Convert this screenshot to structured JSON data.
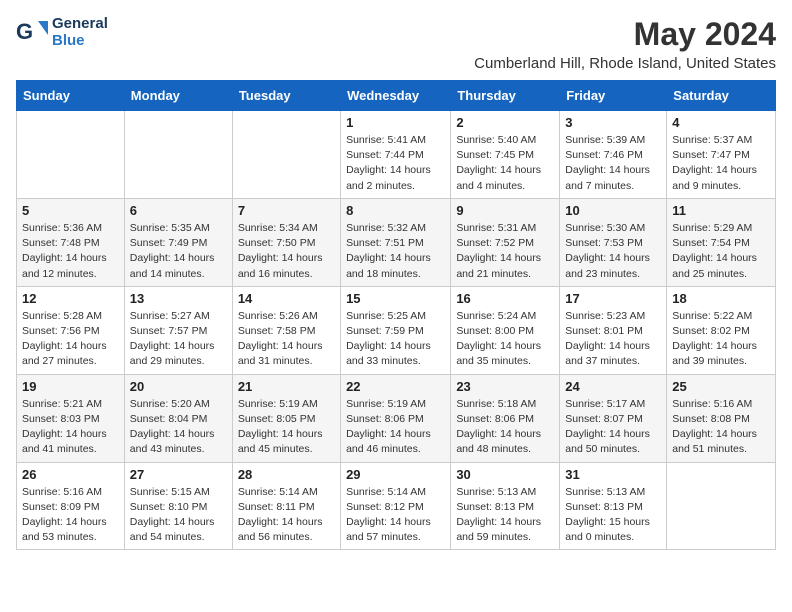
{
  "logo": {
    "line1": "General",
    "line2": "Blue",
    "tagline": ""
  },
  "title": "May 2024",
  "subtitle": "Cumberland Hill, Rhode Island, United States",
  "weekdays": [
    "Sunday",
    "Monday",
    "Tuesday",
    "Wednesday",
    "Thursday",
    "Friday",
    "Saturday"
  ],
  "weeks": [
    [
      {
        "day": "",
        "info": ""
      },
      {
        "day": "",
        "info": ""
      },
      {
        "day": "",
        "info": ""
      },
      {
        "day": "1",
        "info": "Sunrise: 5:41 AM\nSunset: 7:44 PM\nDaylight: 14 hours\nand 2 minutes."
      },
      {
        "day": "2",
        "info": "Sunrise: 5:40 AM\nSunset: 7:45 PM\nDaylight: 14 hours\nand 4 minutes."
      },
      {
        "day": "3",
        "info": "Sunrise: 5:39 AM\nSunset: 7:46 PM\nDaylight: 14 hours\nand 7 minutes."
      },
      {
        "day": "4",
        "info": "Sunrise: 5:37 AM\nSunset: 7:47 PM\nDaylight: 14 hours\nand 9 minutes."
      }
    ],
    [
      {
        "day": "5",
        "info": "Sunrise: 5:36 AM\nSunset: 7:48 PM\nDaylight: 14 hours\nand 12 minutes."
      },
      {
        "day": "6",
        "info": "Sunrise: 5:35 AM\nSunset: 7:49 PM\nDaylight: 14 hours\nand 14 minutes."
      },
      {
        "day": "7",
        "info": "Sunrise: 5:34 AM\nSunset: 7:50 PM\nDaylight: 14 hours\nand 16 minutes."
      },
      {
        "day": "8",
        "info": "Sunrise: 5:32 AM\nSunset: 7:51 PM\nDaylight: 14 hours\nand 18 minutes."
      },
      {
        "day": "9",
        "info": "Sunrise: 5:31 AM\nSunset: 7:52 PM\nDaylight: 14 hours\nand 21 minutes."
      },
      {
        "day": "10",
        "info": "Sunrise: 5:30 AM\nSunset: 7:53 PM\nDaylight: 14 hours\nand 23 minutes."
      },
      {
        "day": "11",
        "info": "Sunrise: 5:29 AM\nSunset: 7:54 PM\nDaylight: 14 hours\nand 25 minutes."
      }
    ],
    [
      {
        "day": "12",
        "info": "Sunrise: 5:28 AM\nSunset: 7:56 PM\nDaylight: 14 hours\nand 27 minutes."
      },
      {
        "day": "13",
        "info": "Sunrise: 5:27 AM\nSunset: 7:57 PM\nDaylight: 14 hours\nand 29 minutes."
      },
      {
        "day": "14",
        "info": "Sunrise: 5:26 AM\nSunset: 7:58 PM\nDaylight: 14 hours\nand 31 minutes."
      },
      {
        "day": "15",
        "info": "Sunrise: 5:25 AM\nSunset: 7:59 PM\nDaylight: 14 hours\nand 33 minutes."
      },
      {
        "day": "16",
        "info": "Sunrise: 5:24 AM\nSunset: 8:00 PM\nDaylight: 14 hours\nand 35 minutes."
      },
      {
        "day": "17",
        "info": "Sunrise: 5:23 AM\nSunset: 8:01 PM\nDaylight: 14 hours\nand 37 minutes."
      },
      {
        "day": "18",
        "info": "Sunrise: 5:22 AM\nSunset: 8:02 PM\nDaylight: 14 hours\nand 39 minutes."
      }
    ],
    [
      {
        "day": "19",
        "info": "Sunrise: 5:21 AM\nSunset: 8:03 PM\nDaylight: 14 hours\nand 41 minutes."
      },
      {
        "day": "20",
        "info": "Sunrise: 5:20 AM\nSunset: 8:04 PM\nDaylight: 14 hours\nand 43 minutes."
      },
      {
        "day": "21",
        "info": "Sunrise: 5:19 AM\nSunset: 8:05 PM\nDaylight: 14 hours\nand 45 minutes."
      },
      {
        "day": "22",
        "info": "Sunrise: 5:19 AM\nSunset: 8:06 PM\nDaylight: 14 hours\nand 46 minutes."
      },
      {
        "day": "23",
        "info": "Sunrise: 5:18 AM\nSunset: 8:06 PM\nDaylight: 14 hours\nand 48 minutes."
      },
      {
        "day": "24",
        "info": "Sunrise: 5:17 AM\nSunset: 8:07 PM\nDaylight: 14 hours\nand 50 minutes."
      },
      {
        "day": "25",
        "info": "Sunrise: 5:16 AM\nSunset: 8:08 PM\nDaylight: 14 hours\nand 51 minutes."
      }
    ],
    [
      {
        "day": "26",
        "info": "Sunrise: 5:16 AM\nSunset: 8:09 PM\nDaylight: 14 hours\nand 53 minutes."
      },
      {
        "day": "27",
        "info": "Sunrise: 5:15 AM\nSunset: 8:10 PM\nDaylight: 14 hours\nand 54 minutes."
      },
      {
        "day": "28",
        "info": "Sunrise: 5:14 AM\nSunset: 8:11 PM\nDaylight: 14 hours\nand 56 minutes."
      },
      {
        "day": "29",
        "info": "Sunrise: 5:14 AM\nSunset: 8:12 PM\nDaylight: 14 hours\nand 57 minutes."
      },
      {
        "day": "30",
        "info": "Sunrise: 5:13 AM\nSunset: 8:13 PM\nDaylight: 14 hours\nand 59 minutes."
      },
      {
        "day": "31",
        "info": "Sunrise: 5:13 AM\nSunset: 8:13 PM\nDaylight: 15 hours\nand 0 minutes."
      },
      {
        "day": "",
        "info": ""
      }
    ]
  ]
}
